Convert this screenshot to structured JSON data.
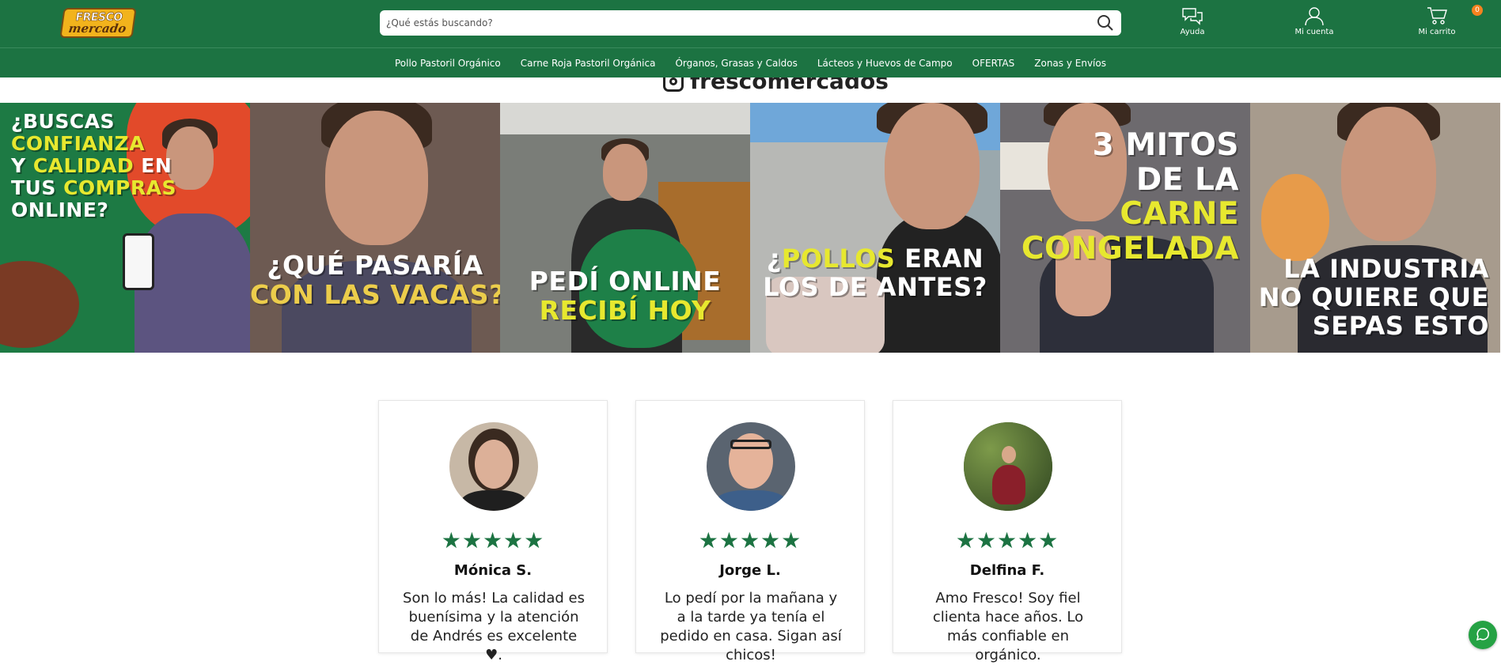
{
  "brand": {
    "logo_line1": "FRESCO",
    "logo_line2": "mercado",
    "primary_color": "#1c7342",
    "accent_color": "#f5821f"
  },
  "search": {
    "placeholder": "¿Qué estás buscando?",
    "value": ""
  },
  "header_actions": {
    "help_label": "Ayuda",
    "account_label": "Mi cuenta",
    "cart_label": "Mi carrito",
    "cart_count": "0"
  },
  "nav": {
    "items": [
      "Pollo Pastoril Orgánico",
      "Carne Roja Pastoril Orgánica",
      "Órganos, Grasas y Caldos",
      "Lácteos y Huevos de Campo",
      "OFERTAS",
      "Zonas y Envíos"
    ]
  },
  "instagram": {
    "handle": "frescomercados"
  },
  "videos": [
    {
      "lines": [
        [
          {
            "t": "¿BUSCAS",
            "c": "w"
          }
        ],
        [
          {
            "t": "CONFIANZA",
            "c": "y"
          }
        ],
        [
          {
            "t": "Y ",
            "c": "w"
          },
          {
            "t": "CALIDAD",
            "c": "y"
          },
          {
            "t": " EN",
            "c": "w"
          }
        ],
        [
          {
            "t": "TUS ",
            "c": "w"
          },
          {
            "t": "COMPRAS",
            "c": "y"
          }
        ],
        [
          {
            "t": "ONLINE?",
            "c": "w"
          }
        ]
      ]
    },
    {
      "lines": [
        [
          {
            "t": "¿QUÉ PASARÍA",
            "c": "w"
          }
        ],
        [
          {
            "t": "CON LAS VACAS?",
            "c": "t"
          }
        ]
      ]
    },
    {
      "lines": [
        [
          {
            "t": "PEDÍ ONLINE",
            "c": "w"
          }
        ],
        [
          {
            "t": "RECIBÍ HOY",
            "c": "y"
          }
        ]
      ]
    },
    {
      "lines": [
        [
          {
            "t": "¿",
            "c": "w"
          },
          {
            "t": "POLLOS",
            "c": "y"
          },
          {
            "t": " ERAN",
            "c": "w"
          }
        ],
        [
          {
            "t": "LOS DE ANTES?",
            "c": "w"
          }
        ]
      ]
    },
    {
      "lines": [
        [
          {
            "t": "3 MITOS",
            "c": "w"
          }
        ],
        [
          {
            "t": "DE LA",
            "c": "w"
          }
        ],
        [
          {
            "t": "CARNE",
            "c": "y"
          }
        ],
        [
          {
            "t": "CONGELADA",
            "c": "y"
          }
        ]
      ]
    },
    {
      "lines": [
        [
          {
            "t": "LA INDUSTRIA",
            "c": "w"
          }
        ],
        [
          {
            "t": "NO QUIERE QUE",
            "c": "w"
          }
        ],
        [
          {
            "t": "SEPAS ESTO",
            "c": "w"
          }
        ]
      ]
    }
  ],
  "testimonials": [
    {
      "name": "Mónica S.",
      "rating": 5,
      "stars": "★★★★★",
      "text": "Son lo más! La calidad es buenísima y la atención de Andrés es excelente ♥."
    },
    {
      "name": "Jorge L.",
      "rating": 5,
      "stars": "★★★★★",
      "text": "Lo pedí por la mañana y a la tarde ya tenía el pedido en casa. Sigan así chicos!"
    },
    {
      "name": "Delfina F.",
      "rating": 5,
      "stars": "★★★★★",
      "text": "Amo Fresco! Soy fiel clienta hace años. Lo más confiable en orgánico."
    }
  ],
  "icons": {
    "search": "search-icon",
    "help": "chat-bubbles-icon",
    "account": "user-icon",
    "cart": "cart-icon",
    "instagram": "instagram-icon",
    "whatsapp": "whatsapp-icon"
  }
}
